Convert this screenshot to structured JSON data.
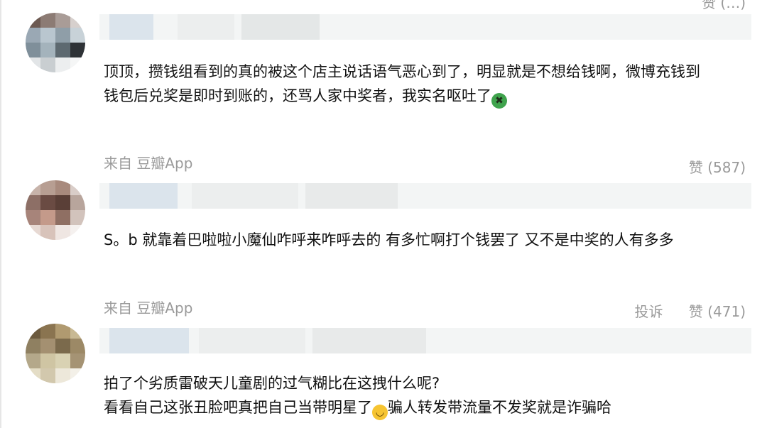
{
  "top_like": "赞 (…)",
  "comments": [
    {
      "text_lines": [
        "顶顶，攒钱组看到的真的被这个店主说话语气恶心到了，明显就是不想给钱啊，微博充钱到",
        "钱包后兑奖是即时到账的，还骂人家中奖者，我实名呕吐了"
      ],
      "emoji": "vomit-emoji",
      "source": "来自 豆瓣App",
      "likes": "赞 (587)"
    },
    {
      "text_lines": [
        "S。b 就靠着巴啦啦小魔仙咋呼来咋呼去的 有多忙啊打个钱罢了 又不是中奖的人有多多"
      ],
      "source": "来自 豆瓣App",
      "report": "投诉",
      "likes": "赞 (471)"
    },
    {
      "text_lines": [
        "拍了个劣质雷破天儿童剧的过气糊比在这拽什么呢?",
        "看看自己这张丑脸吧真把自己当带明星了",
        "骗人转发带流量不发奖就是诈骗哈"
      ],
      "emoji": "grin-emoji"
    }
  ],
  "colors": {
    "meta": "#9a9a9a",
    "name_bar": "#f3f5f5",
    "text": "#111111"
  }
}
